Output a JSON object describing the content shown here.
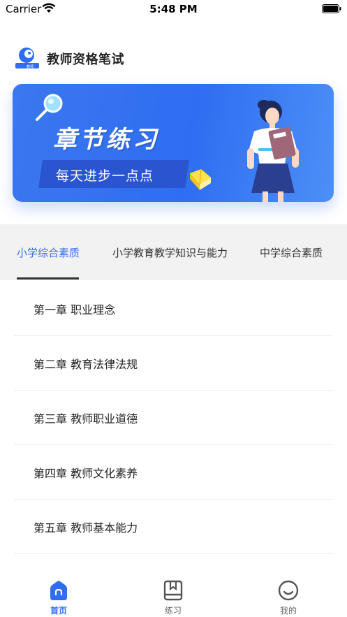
{
  "status_bar": {
    "carrier": "Carrier",
    "time": "5:48 PM"
  },
  "header": {
    "title": "教师资格笔试"
  },
  "banner": {
    "title": "章节练习",
    "subtitle": "每天进步一点点"
  },
  "tabs": [
    {
      "label": "小学综合素质",
      "active": true
    },
    {
      "label": "小学教育教学知识与能力",
      "active": false
    },
    {
      "label": "中学综合素质",
      "active": false
    }
  ],
  "chapters": [
    {
      "label": "第一章 职业理念"
    },
    {
      "label": "第二章 教育法律法规"
    },
    {
      "label": "第三章 教师职业道德"
    },
    {
      "label": "第四章 教师文化素养"
    },
    {
      "label": "第五章 教师基本能力"
    }
  ],
  "bottom_nav": [
    {
      "label": "首页",
      "icon": "home-icon",
      "active": true
    },
    {
      "label": "练习",
      "icon": "practice-book-icon",
      "active": false
    },
    {
      "label": "我的",
      "icon": "profile-smile-icon",
      "active": false
    }
  ],
  "colors": {
    "accent": "#2f6df2",
    "tab_bg": "#f2f2f2",
    "banner": "#3a78f0"
  }
}
